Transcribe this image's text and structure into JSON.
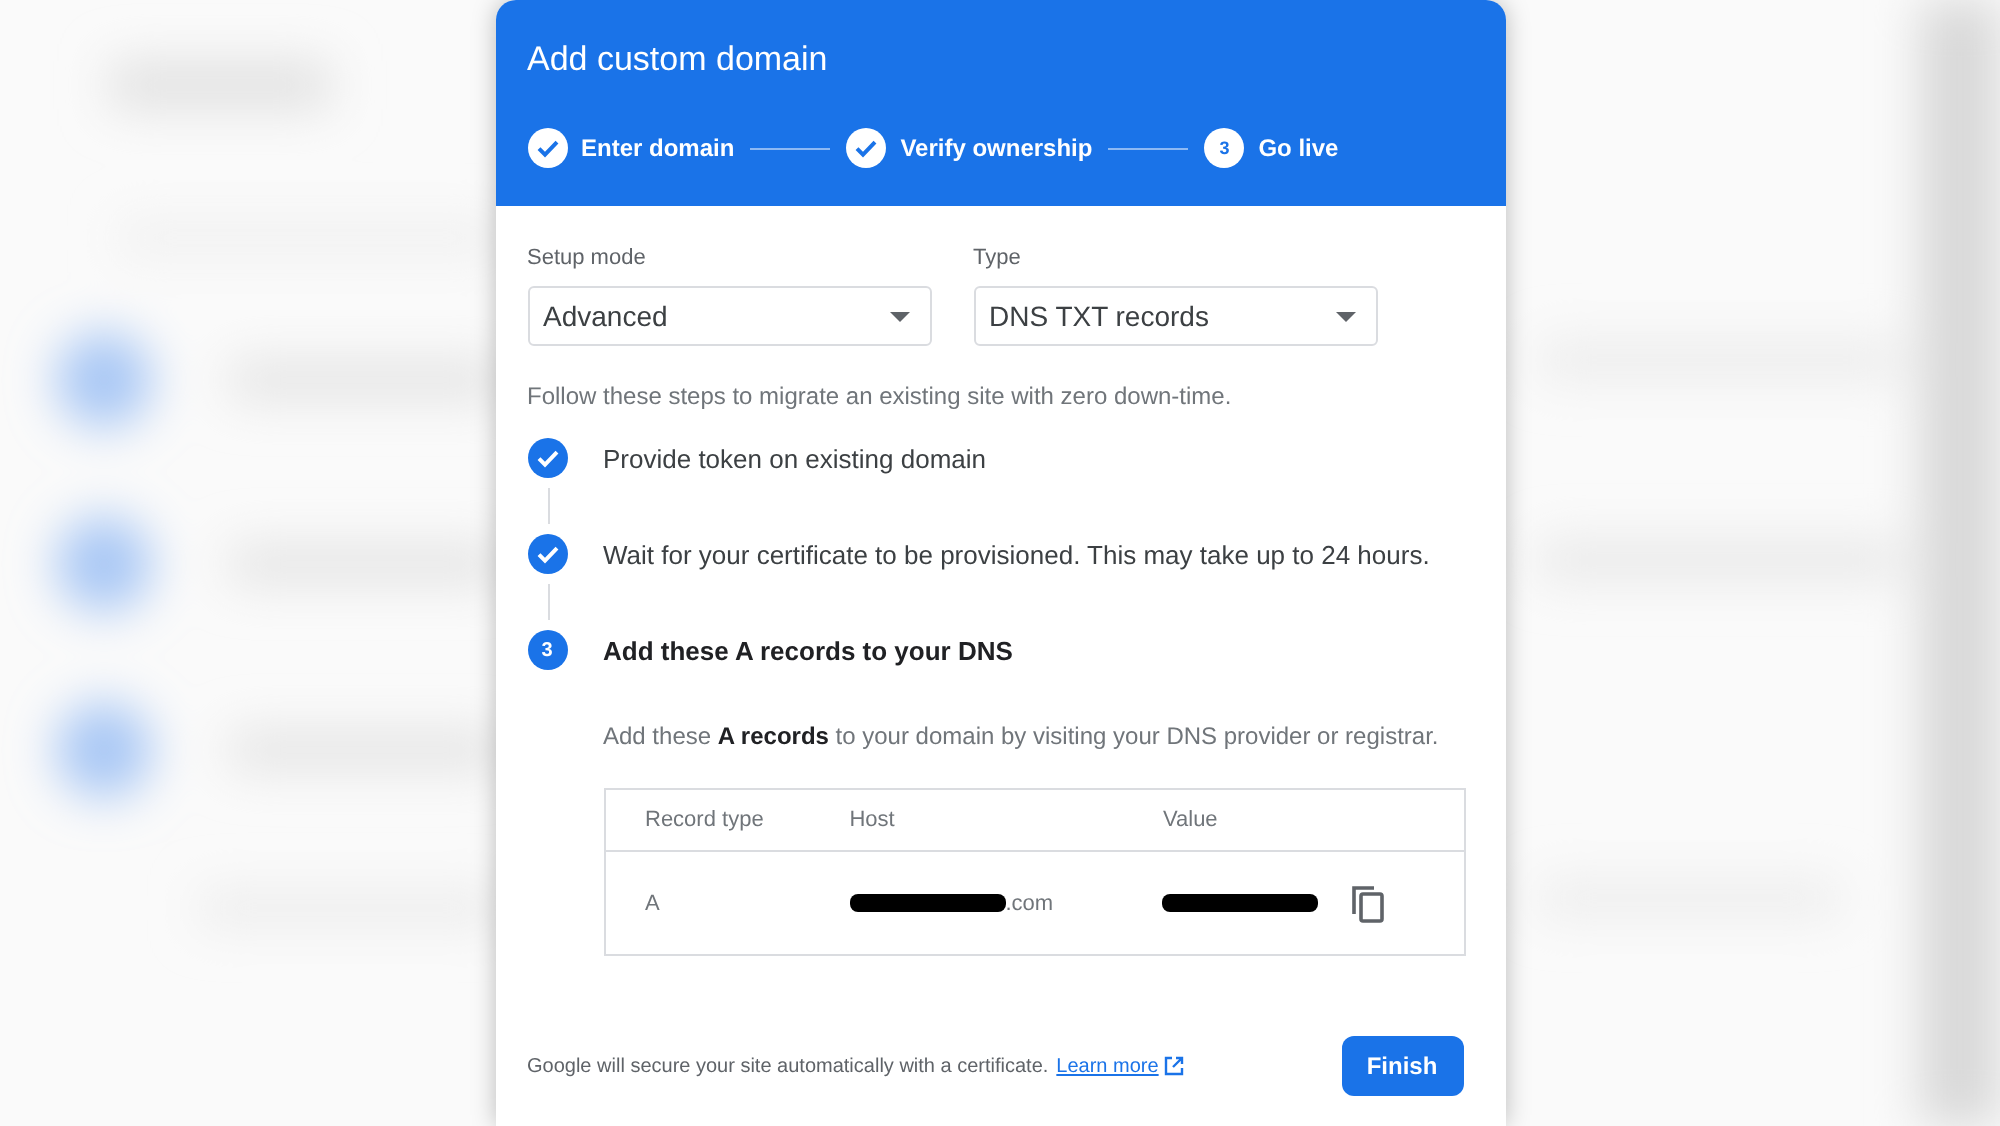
{
  "dialog": {
    "title": "Add custom domain",
    "progress": [
      {
        "label": "Enter domain",
        "done": true
      },
      {
        "label": "Verify ownership",
        "done": true
      },
      {
        "label": "Go live",
        "done": false,
        "number": "3"
      }
    ],
    "fields": [
      {
        "label": "Setup mode",
        "value": "Advanced"
      },
      {
        "label": "Type",
        "value": "DNS TXT records"
      }
    ],
    "intro": "Follow these steps to migrate an existing site with zero down-time.",
    "steps": [
      {
        "text": "Provide token on existing domain",
        "done": true
      },
      {
        "text": "Wait for your certificate to be provisioned. This may take up to 24 hours.",
        "done": true
      },
      {
        "text": "Add these A records to your DNS",
        "done": false,
        "number": "3",
        "detail": "Add these **A records** to your domain by visiting your DNS provider or registrar."
      }
    ],
    "table": {
      "columns": [
        "Record type",
        "Host",
        "Value"
      ],
      "rows": [
        {
          "record_type": "A",
          "host": ".com",
          "host_redacted": true,
          "value_redacted": true
        }
      ]
    },
    "footer": {
      "note": "Google will secure your site automatically with a certificate.",
      "link": "Learn more"
    },
    "buttons": [
      "Finish"
    ]
  }
}
